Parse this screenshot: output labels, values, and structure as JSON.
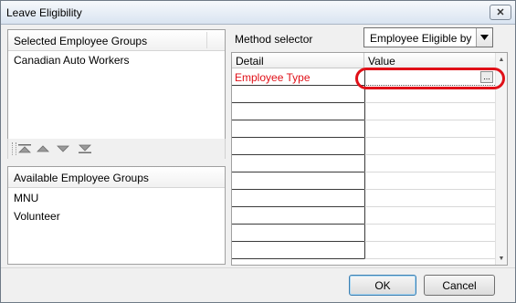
{
  "window": {
    "title": "Leave Eligibility"
  },
  "selected_groups": {
    "header": "Selected Employee Groups",
    "items": [
      "Canadian Auto Workers"
    ]
  },
  "toolbar": {
    "icons": [
      "move-top-icon",
      "move-up-icon",
      "move-down-icon",
      "move-bottom-icon"
    ]
  },
  "available_groups": {
    "header": "Available Employee Groups",
    "items": [
      "MNU",
      "Volunteer"
    ]
  },
  "method_selector": {
    "label": "Method selector",
    "value": "Employee Eligible by"
  },
  "grid": {
    "columns": [
      "Detail",
      "Value"
    ],
    "rows": [
      {
        "detail": "Employee Type",
        "value": "",
        "color": "#e01018"
      }
    ],
    "ellipsis": "..."
  },
  "buttons": {
    "ok": "OK",
    "cancel": "Cancel"
  },
  "colors": {
    "highlight": "#e01018",
    "title_bg": "#dbe6f3"
  }
}
